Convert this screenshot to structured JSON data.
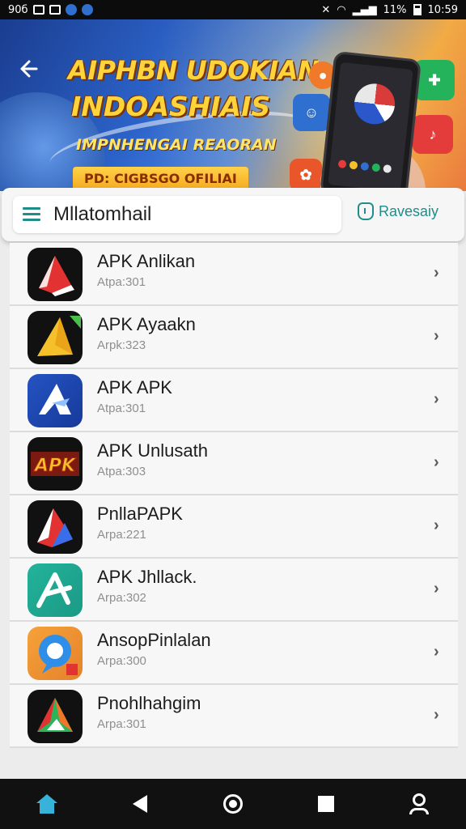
{
  "status_bar": {
    "left_text": "90б",
    "time": "10:59",
    "battery": "11%"
  },
  "banner": {
    "title": "AIPHBN UDOKIAN",
    "subtitle": "INDOASHIAIS",
    "tagline": "IMPNHENGAI REAORAN",
    "pill": "PD: CIGBSGO OFILIAI"
  },
  "search": {
    "value": "Mllatomhail"
  },
  "recent_button": {
    "label": "Ravesaiy"
  },
  "apps": [
    {
      "name": "APK Anlikan",
      "meta": "Atpa:301"
    },
    {
      "name": "APK Ayaakn",
      "meta": "Arpk:323"
    },
    {
      "name": "APK APK",
      "meta": "Atpa:301"
    },
    {
      "name": "APK Unlusath",
      "meta": "Atpa:303"
    },
    {
      "name": "PnllaPAPK",
      "meta": "Arpa:221"
    },
    {
      "name": "APK Jhllack.",
      "meta": "Arpa:302"
    },
    {
      "name": "AnsopPinlalan",
      "meta": "Arpa:300"
    },
    {
      "name": "Pnohlhahgim",
      "meta": "Arpa:301"
    }
  ],
  "icon_badge_text": "APK",
  "colors": {
    "accent": "#1f8e8a",
    "nav_home": "#37b3d9"
  }
}
